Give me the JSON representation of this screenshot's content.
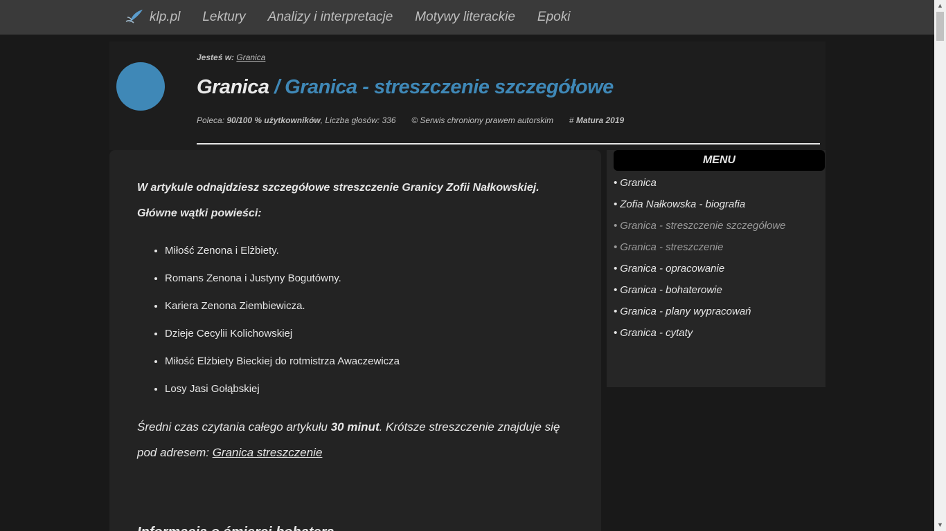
{
  "nav": {
    "logo_text": "klp.pl",
    "links": [
      "Lektury",
      "Analizy i interpretacje",
      "Motywy literackie",
      "Epoki"
    ]
  },
  "header": {
    "breadcrumb_label": "Jesteś w:",
    "breadcrumb_link": "Granica",
    "title_main": "Granica",
    "title_sub": "/ Granica - streszczenie szczegółowe",
    "meta_poleca_label": "Poleca:",
    "meta_poleca_value": "90/100 % użytkowników",
    "meta_votes": ", Liczba głosów: 336",
    "meta_copyright": "© Serwis chroniony prawem autorskim",
    "meta_tag_hash": "#",
    "meta_tag": "Matura 2019"
  },
  "article": {
    "lead": "W artykule odnajdziesz szczegółowe streszczenie Granicy Zofii Nałkowskiej.",
    "threads_heading": "Główne wątki powieści:",
    "threads": [
      "Miłość Zenona i Elżbiety.",
      "Romans Zenona i Justyny Bogutówny.",
      "Kariera Zenona Ziembiewicza.",
      "Dzieje Cecylii Kolichowskiej",
      "Miłość Elżbiety Bieckiej do rotmistrza Awaczewicza",
      "Losy Jasi Gołąbskiej"
    ],
    "reading_prefix": "Średni czas czytania całego artykułu ",
    "reading_time": "30 minut",
    "reading_suffix": ". Krótsze streszczenie znajduje się pod adresem: ",
    "reading_link": "Granica streszczenie",
    "section_title": "Informacja o śmierci bohatera"
  },
  "sidebar": {
    "menu_title": "MENU",
    "bullet": "•",
    "items": [
      {
        "label": "Granica",
        "dim": false
      },
      {
        "label": "Zofia Nałkowska - biografia",
        "dim": false
      },
      {
        "label": "Granica - streszczenie szczegółowe",
        "dim": true
      },
      {
        "label": "Granica - streszczenie",
        "dim": true
      },
      {
        "label": "Granica - opracowanie",
        "dim": false
      },
      {
        "label": "Granica - bohaterowie",
        "dim": false
      },
      {
        "label": "Granica - plany wypracowań",
        "dim": false
      },
      {
        "label": "Granica - cytaty",
        "dim": false
      }
    ]
  },
  "scrollbar": {
    "up_icon": "▲",
    "down_icon": "▼"
  },
  "colors": {
    "accent": "#3f88b7",
    "background": "#191919",
    "topbar": "#3a3a3a"
  }
}
